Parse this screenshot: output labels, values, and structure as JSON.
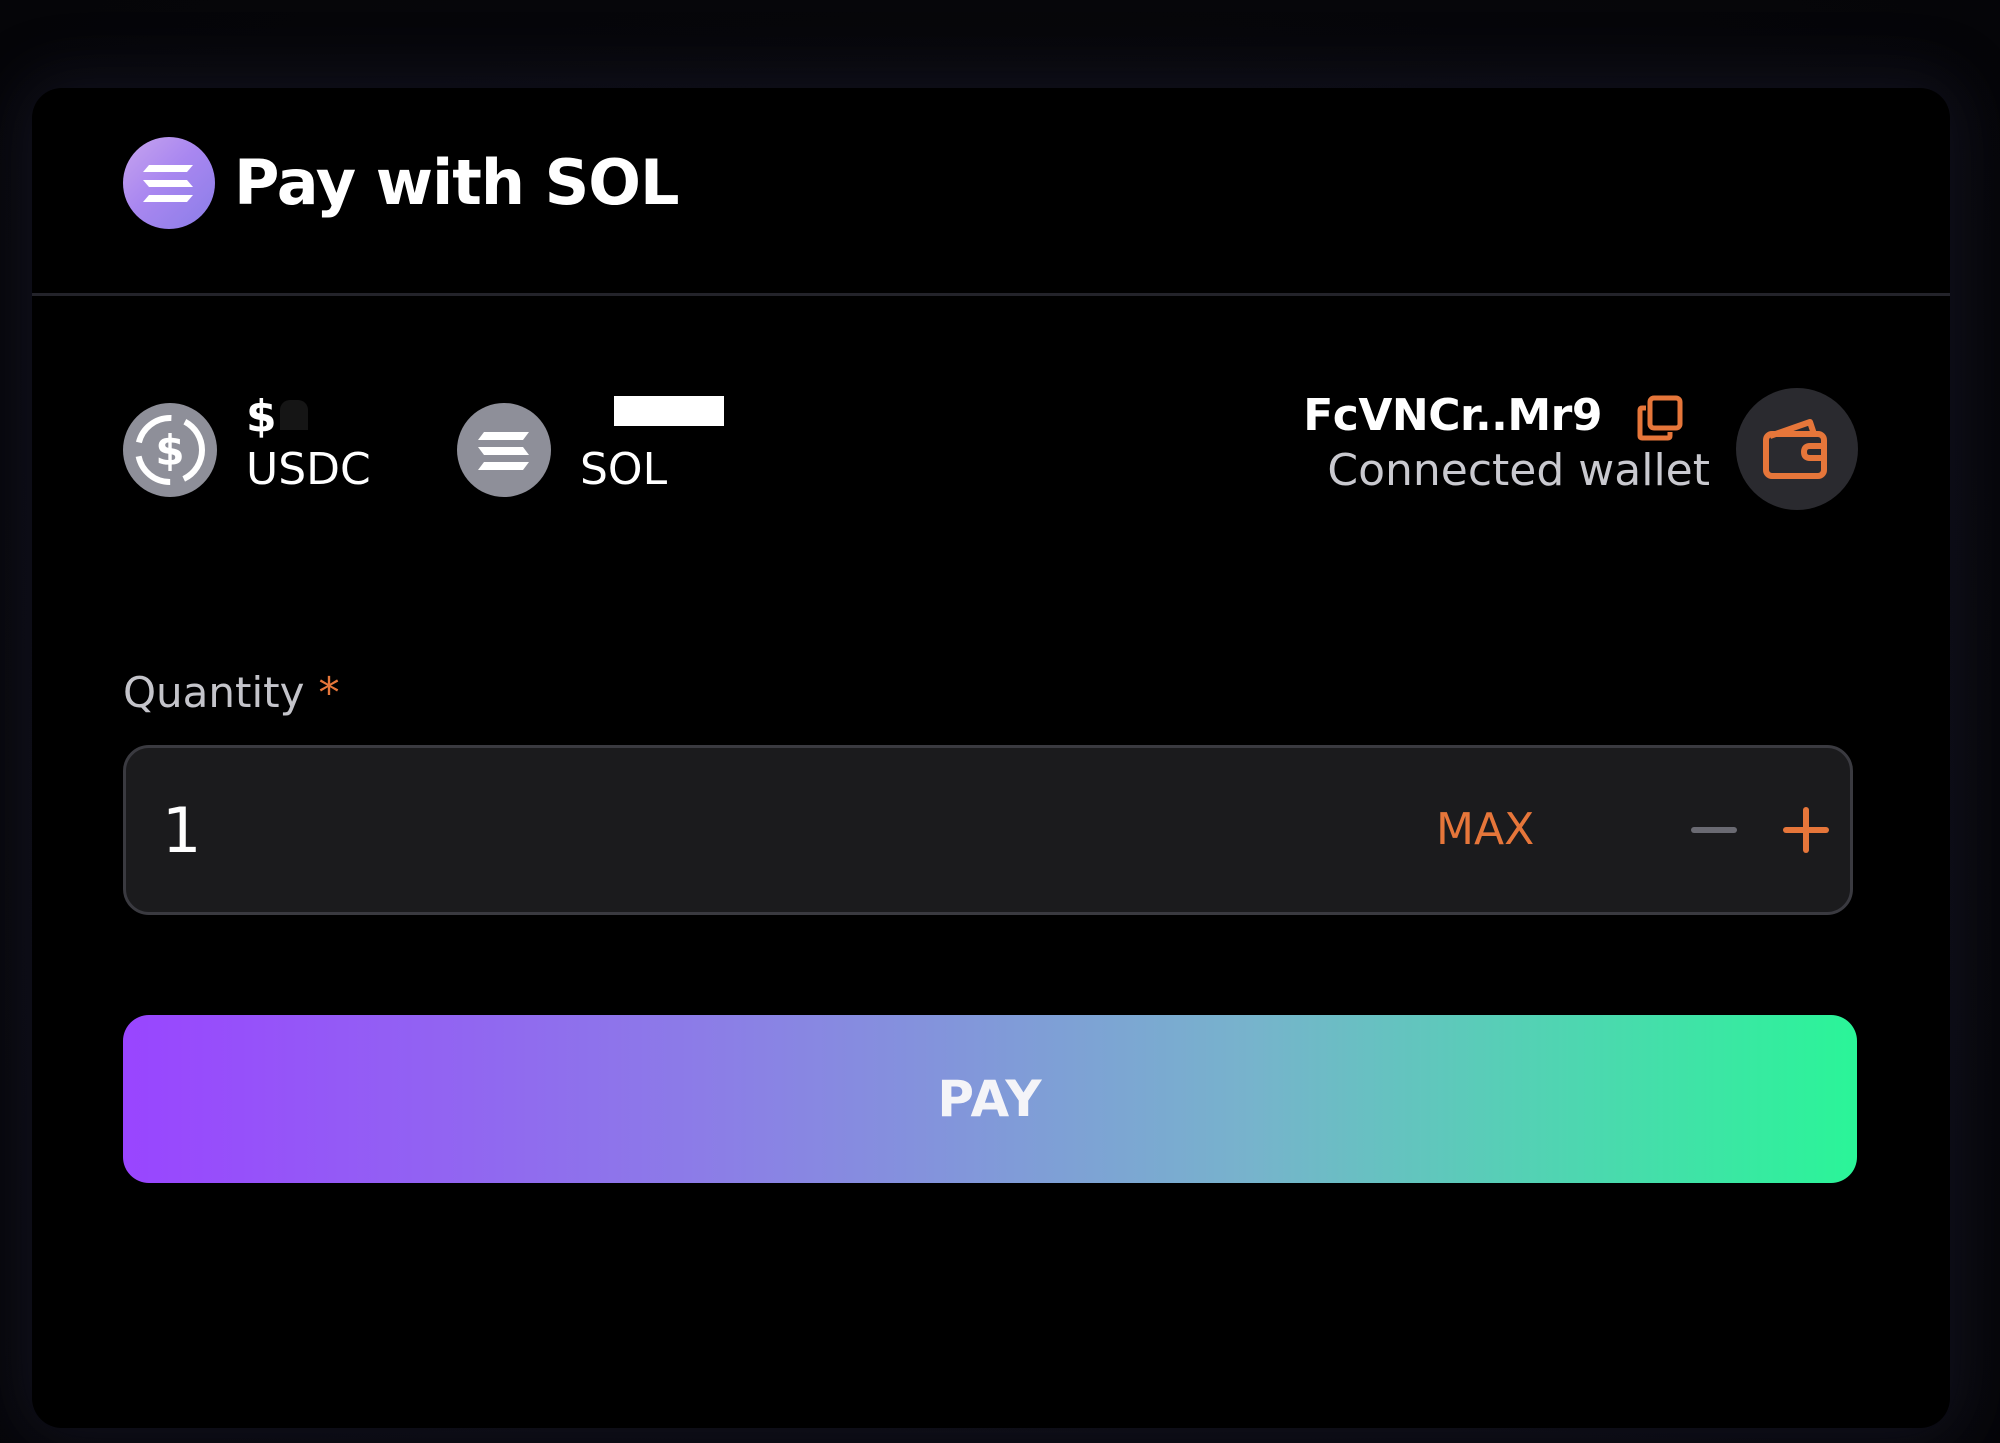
{
  "header": {
    "title": "Pay with SOL",
    "logo_icon": "solana-logo-icon"
  },
  "balances": [
    {
      "symbol": "USDC",
      "value": "$",
      "icon": "usdc-icon"
    },
    {
      "symbol": "SOL",
      "value": "",
      "icon": "solana-icon"
    }
  ],
  "wallet": {
    "address": "FcVNCr..Mr9",
    "label": "Connected wallet",
    "copy_icon": "copy-icon",
    "wallet_icon": "wallet-icon"
  },
  "quantity": {
    "label": "Quantity",
    "required_mark": "*",
    "value": "1",
    "max_label": "MAX"
  },
  "pay_button": {
    "label": "PAY"
  },
  "colors": {
    "accent": "#e6763a",
    "background": "#000000",
    "field_bg": "#1b1b1d",
    "gradient_start": "#9945ff",
    "gradient_end": "#2af598"
  }
}
